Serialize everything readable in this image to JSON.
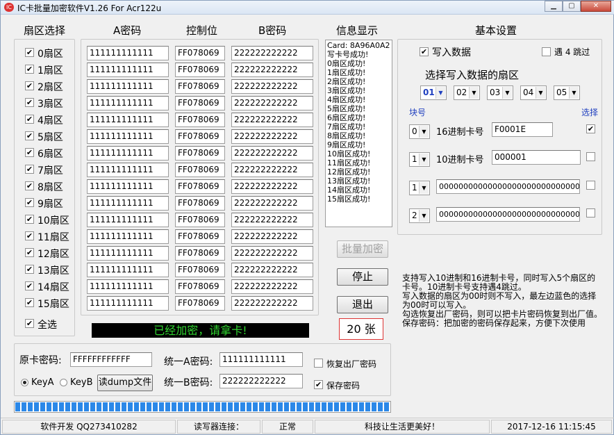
{
  "title": "IC卡批量加密软件V1.26 For Acr122u",
  "headers": {
    "sector_select": "扇区选择",
    "key_a": "A密码",
    "control": "控制位",
    "key_b": "B密码",
    "info": "信息显示",
    "basic": "基本设置"
  },
  "sectors": [
    {
      "label": "0扇区",
      "key_a": "111111111111",
      "ctrl": "FF078069",
      "key_b": "222222222222"
    },
    {
      "label": "1扇区",
      "key_a": "111111111111",
      "ctrl": "FF078069",
      "key_b": "222222222222"
    },
    {
      "label": "2扇区",
      "key_a": "111111111111",
      "ctrl": "FF078069",
      "key_b": "222222222222"
    },
    {
      "label": "3扇区",
      "key_a": "111111111111",
      "ctrl": "FF078069",
      "key_b": "222222222222"
    },
    {
      "label": "4扇区",
      "key_a": "111111111111",
      "ctrl": "FF078069",
      "key_b": "222222222222"
    },
    {
      "label": "5扇区",
      "key_a": "111111111111",
      "ctrl": "FF078069",
      "key_b": "222222222222"
    },
    {
      "label": "6扇区",
      "key_a": "111111111111",
      "ctrl": "FF078069",
      "key_b": "222222222222"
    },
    {
      "label": "7扇区",
      "key_a": "111111111111",
      "ctrl": "FF078069",
      "key_b": "222222222222"
    },
    {
      "label": "8扇区",
      "key_a": "111111111111",
      "ctrl": "FF078069",
      "key_b": "222222222222"
    },
    {
      "label": "9扇区",
      "key_a": "111111111111",
      "ctrl": "FF078069",
      "key_b": "222222222222"
    },
    {
      "label": "10扇区",
      "key_a": "111111111111",
      "ctrl": "FF078069",
      "key_b": "222222222222"
    },
    {
      "label": "11扇区",
      "key_a": "111111111111",
      "ctrl": "FF078069",
      "key_b": "222222222222"
    },
    {
      "label": "12扇区",
      "key_a": "111111111111",
      "ctrl": "FF078069",
      "key_b": "222222222222"
    },
    {
      "label": "13扇区",
      "key_a": "111111111111",
      "ctrl": "FF078069",
      "key_b": "222222222222"
    },
    {
      "label": "14扇区",
      "key_a": "111111111111",
      "ctrl": "FF078069",
      "key_b": "222222222222"
    },
    {
      "label": "15扇区",
      "key_a": "111111111111",
      "ctrl": "FF078069",
      "key_b": "222222222222"
    }
  ],
  "select_all": "全选",
  "info_lines": [
    "Card: 8A96A0A2",
    "写卡号成功!",
    "0扇区成功!",
    "1扇区成功!",
    "2扇区成功!",
    "3扇区成功!",
    "4扇区成功!",
    "5扇区成功!",
    "6扇区成功!",
    "7扇区成功!",
    "8扇区成功!",
    "9扇区成功!",
    "10扇区成功!",
    "11扇区成功!",
    "12扇区成功!",
    "13扇区成功!",
    "14扇区成功!",
    "15扇区成功!"
  ],
  "buttons": {
    "batch": "批量加密",
    "stop": "停止",
    "exit": "退出",
    "read_dump": "读dump文件"
  },
  "message": "已经加密，请拿卡!",
  "count": "20 张",
  "basic": {
    "write_data": "写入数据",
    "skip4": "遇 4 跳过",
    "choose_sector": "选择写入数据的扇区",
    "sector_selects": [
      "01",
      "02",
      "03",
      "04",
      "05"
    ],
    "block_label": "块号",
    "select_label": "选择",
    "rows": [
      {
        "block": "0",
        "label": "16进制卡号",
        "value": "F0001E",
        "checked": "✔"
      },
      {
        "block": "1",
        "label": "10进制卡号",
        "value": "000001",
        "checked": ""
      },
      {
        "block": "1",
        "label": "",
        "value": "00000000000000000000000000000000",
        "checked": ""
      },
      {
        "block": "2",
        "label": "",
        "value": "00000000000000000000000000000000",
        "checked": ""
      }
    ]
  },
  "notes": [
    "支持写入10进制和16进制卡号，同时写入5个扇区的卡号。10进制卡号支持遇4跳过。",
    "写入数据的扇区为00时则不写入，最左边蓝色的选择为00时可以写入。",
    "勾选恢复出厂密码，则可以把卡片密码恢复到出厂值。",
    "保存密码：把加密的密码保存起来，方便下次使用"
  ],
  "bottom": {
    "orig_label": "原卡密码:",
    "orig_value": "FFFFFFFFFFFF",
    "unified_a_label": "统一A密码:",
    "unified_a": "111111111111",
    "unified_b_label": "统一B密码:",
    "unified_b": "222222222222",
    "restore": "恢复出厂密码",
    "save": "保存密码",
    "keya": "KeyA",
    "keyb": "KeyB"
  },
  "progress_percent": 100,
  "statusbar": [
    "软件开发 QQ273410282",
    "读写器连接：",
    "正常",
    "科技让生活更美好！",
    "2017-12-16 11:15:45"
  ]
}
